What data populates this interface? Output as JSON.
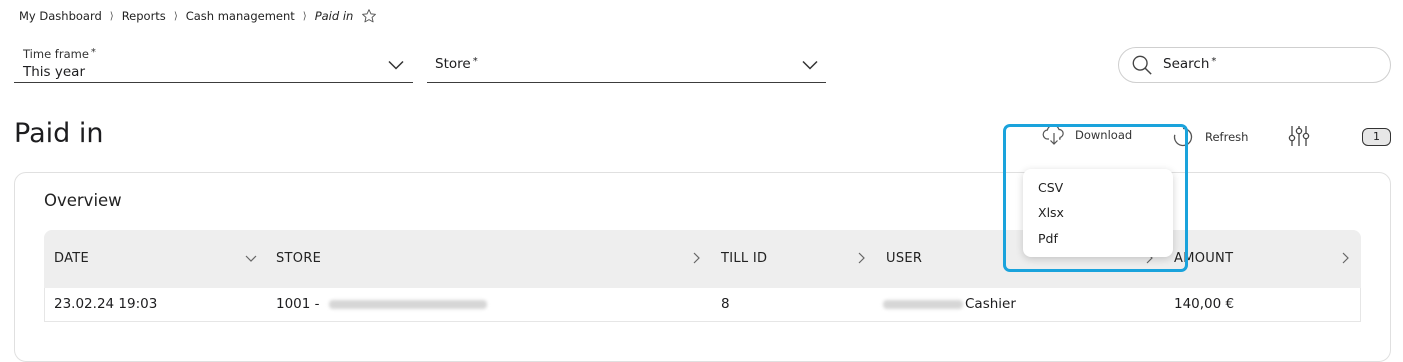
{
  "breadcrumb": {
    "items": [
      "My Dashboard",
      "Reports",
      "Cash management"
    ],
    "current": "Paid in",
    "separator": "⟩"
  },
  "filters": {
    "timeframe": {
      "label": "Time frame",
      "required": "*",
      "value": "This year"
    },
    "store": {
      "label": "Store",
      "required": "*"
    }
  },
  "search": {
    "placeholder": "Search",
    "required": "*"
  },
  "page": {
    "title": "Paid in"
  },
  "toolbar": {
    "download_label": "Download",
    "refresh_label": "Refresh",
    "badge_count": "1"
  },
  "download_menu": {
    "items": [
      "CSV",
      "Xlsx",
      "Pdf"
    ]
  },
  "overview": {
    "title": "Overview",
    "columns": [
      "DATE",
      "STORE",
      "TILL ID",
      "USER",
      "AMOUNT"
    ],
    "rows": [
      {
        "date": "23.02.24 19:03",
        "store_prefix": "1001 -",
        "till_id": "8",
        "user_suffix": "Cashier",
        "amount": "140,00 €"
      }
    ]
  },
  "colors": {
    "highlight": "#1aa3dc",
    "header_bg": "#eeeeee",
    "text": "#1d1d1f"
  }
}
